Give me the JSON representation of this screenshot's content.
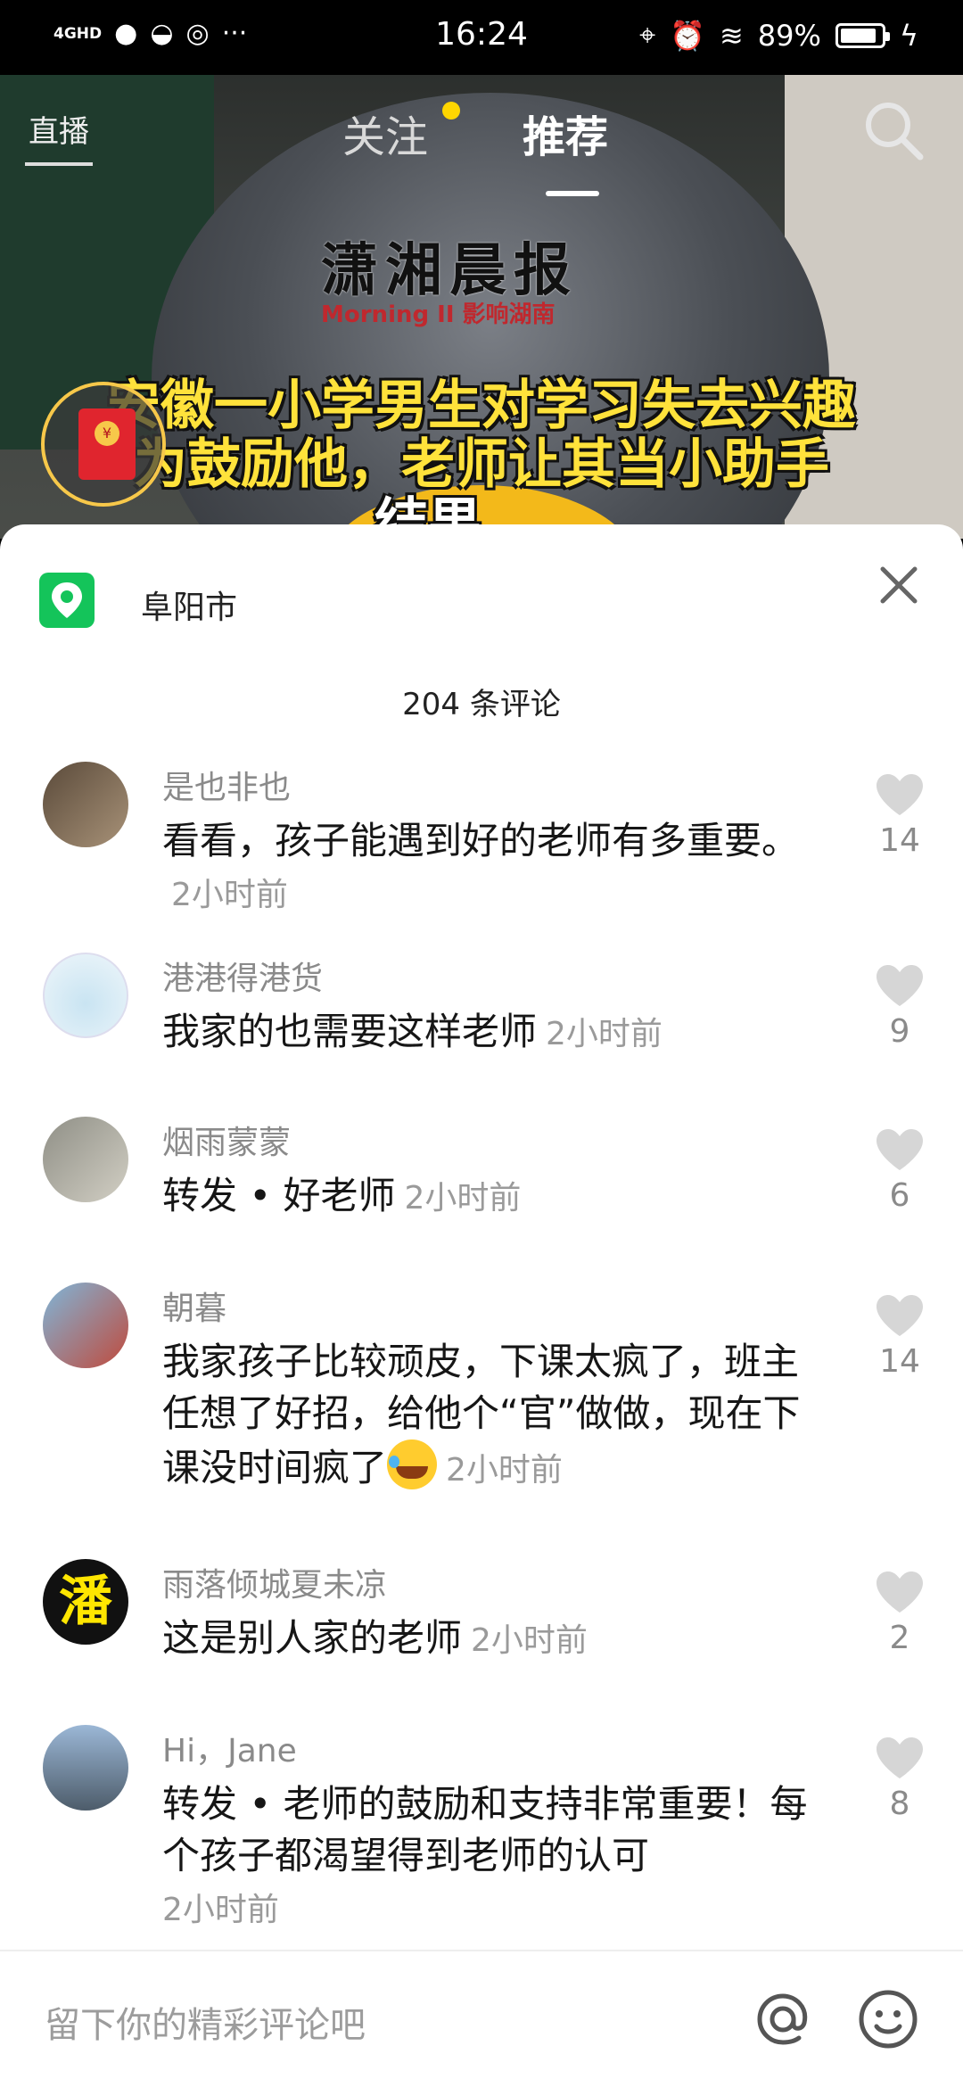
{
  "status_bar": {
    "network": "4GHD",
    "time": "16:24",
    "battery": "89%",
    "battery_level": 0.89
  },
  "top_nav": {
    "live_label": "直播",
    "follow_tab": "关注",
    "recommend_tab": "推荐",
    "search_icon": "search-icon"
  },
  "video": {
    "brand": "潇湘晨报",
    "brand_sub": "Morning II 影响湖南",
    "headline_line1": "安徽一小学男生对学习失去兴趣",
    "headline_line2": "为鼓励他，老师让其当小助手",
    "headline_line3": "结果……"
  },
  "comments_panel": {
    "location": "阜阳市",
    "count_label": "204 条评论",
    "comments": [
      {
        "user": "是也非也",
        "text": "看看，孩子能遇到好的老师有多重要。",
        "time": "2小时前",
        "likes": "14"
      },
      {
        "user": "港港得港货",
        "text": "我家的也需要这样老师",
        "time": "2小时前",
        "likes": "9"
      },
      {
        "user": "烟雨蒙蒙",
        "text": "转发 • 好老师",
        "time": "2小时前",
        "likes": "6"
      },
      {
        "user": "朝暮",
        "text": "我家孩子比较顽皮，下课太疯了，班主任想了好招，给他个“官”做做，现在下课没时间疯了",
        "time": "2小时前",
        "likes": "14"
      },
      {
        "user": "雨落倾城夏未凉",
        "text": "这是别人家的老师",
        "time": "2小时前",
        "likes": "2"
      },
      {
        "user": "Hi，Jane",
        "text": "转发 • 老师的鼓励和支持非常重要！每个孩子都渴望得到老师的认可",
        "time": "2小时前",
        "likes": "8"
      }
    ],
    "input_placeholder": "留下你的精彩评论吧"
  },
  "colors": {
    "accent_green": "#14c45a",
    "headline_yellow": "#ffe23b",
    "follow_dot": "#ffd600"
  }
}
